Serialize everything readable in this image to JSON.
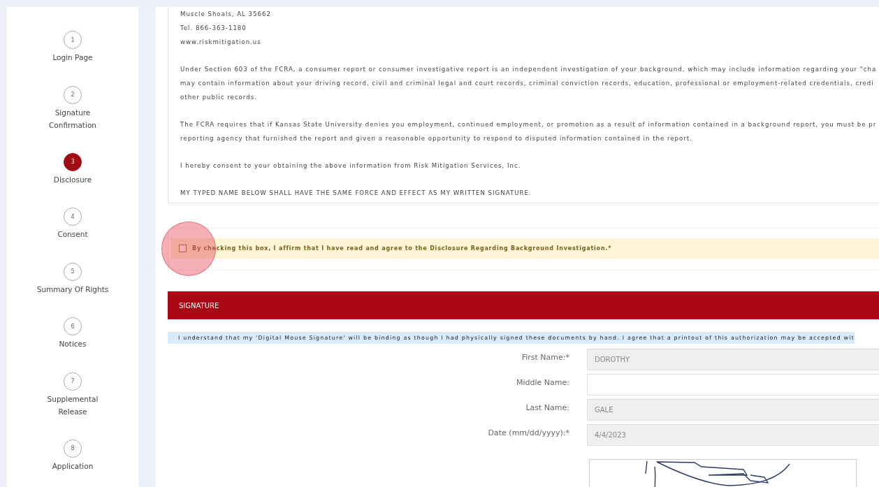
{
  "steps": [
    {
      "number": "1",
      "label": "Login Page",
      "selected": false
    },
    {
      "number": "2",
      "label": "Signature Confirmation",
      "selected": false
    },
    {
      "number": "3",
      "label": "Disclosure",
      "selected": true
    },
    {
      "number": "4",
      "label": "Consent",
      "selected": false
    },
    {
      "number": "5",
      "label": "Summary Of Rights",
      "selected": false
    },
    {
      "number": "6",
      "label": "Notices",
      "selected": false
    },
    {
      "number": "7",
      "label": "Supplemental Release",
      "selected": false
    },
    {
      "number": "8",
      "label": "Application",
      "selected": false
    }
  ],
  "disclosure": {
    "address_lines": [
      "Muscle Shoals, AL 35662",
      "Tel. 866-363-1180",
      "www.riskmitigation.us"
    ],
    "paragraphs": [
      [
        "Under Section 603 of the FCRA, a consumer report or consumer investigative report is an independent investigation of your background, which may include information regarding your \"cha",
        "may contain information about your driving record, civil and criminal legal and court records, criminal conviction records, education, professional or employment-related credentials, credi",
        "other public records."
      ],
      [
        "The FCRA requires that if Kansas State University denies you employment, continued employment, or promotion as a result of information contained in a background report, you must be pr",
        "reporting agency that furnished the report and given a reasonable opportunity to respond to disputed information contained in the report."
      ],
      [
        "I hereby consent to your obtaining the above information from Risk Mitigation Services, Inc."
      ],
      [
        "MY TYPED NAME BELOW SHALL HAVE THE SAME FORCE AND EFFECT AS MY WRITTEN SIGNATURE."
      ]
    ]
  },
  "agreement": {
    "label": "By checking this box, I affirm that I have read and agree to the Disclosure Regarding Background Investigation.*",
    "checked": false
  },
  "signature": {
    "title": "SIGNATURE",
    "notice": "I understand that my 'Digital Mouse Signature' will be binding as though I had physically signed these documents by hand. I agree that a printout of this authorization may be accepted wit",
    "fields": [
      {
        "label": "First Name:*",
        "value": "DOROTHY",
        "disabled": true
      },
      {
        "label": "Middle Name:",
        "disabled": false
      },
      {
        "label": "Last Name:",
        "value": "GALE",
        "disabled": true
      },
      {
        "label": "Date (mm/dd/yyyy):*",
        "value": "4/4/2023",
        "disabled": true
      }
    ]
  }
}
